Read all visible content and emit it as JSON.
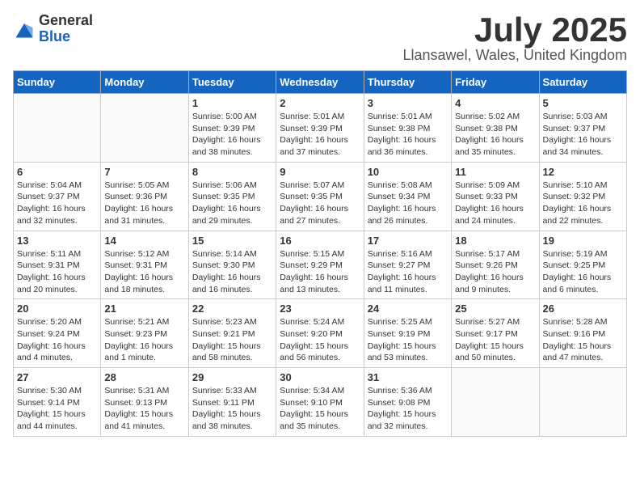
{
  "logo": {
    "general": "General",
    "blue": "Blue"
  },
  "title": "July 2025",
  "location": "Llansawel, Wales, United Kingdom",
  "weekdays": [
    "Sunday",
    "Monday",
    "Tuesday",
    "Wednesday",
    "Thursday",
    "Friday",
    "Saturday"
  ],
  "weeks": [
    [
      {
        "day": "",
        "info": ""
      },
      {
        "day": "",
        "info": ""
      },
      {
        "day": "1",
        "info": "Sunrise: 5:00 AM\nSunset: 9:39 PM\nDaylight: 16 hours\nand 38 minutes."
      },
      {
        "day": "2",
        "info": "Sunrise: 5:01 AM\nSunset: 9:39 PM\nDaylight: 16 hours\nand 37 minutes."
      },
      {
        "day": "3",
        "info": "Sunrise: 5:01 AM\nSunset: 9:38 PM\nDaylight: 16 hours\nand 36 minutes."
      },
      {
        "day": "4",
        "info": "Sunrise: 5:02 AM\nSunset: 9:38 PM\nDaylight: 16 hours\nand 35 minutes."
      },
      {
        "day": "5",
        "info": "Sunrise: 5:03 AM\nSunset: 9:37 PM\nDaylight: 16 hours\nand 34 minutes."
      }
    ],
    [
      {
        "day": "6",
        "info": "Sunrise: 5:04 AM\nSunset: 9:37 PM\nDaylight: 16 hours\nand 32 minutes."
      },
      {
        "day": "7",
        "info": "Sunrise: 5:05 AM\nSunset: 9:36 PM\nDaylight: 16 hours\nand 31 minutes."
      },
      {
        "day": "8",
        "info": "Sunrise: 5:06 AM\nSunset: 9:35 PM\nDaylight: 16 hours\nand 29 minutes."
      },
      {
        "day": "9",
        "info": "Sunrise: 5:07 AM\nSunset: 9:35 PM\nDaylight: 16 hours\nand 27 minutes."
      },
      {
        "day": "10",
        "info": "Sunrise: 5:08 AM\nSunset: 9:34 PM\nDaylight: 16 hours\nand 26 minutes."
      },
      {
        "day": "11",
        "info": "Sunrise: 5:09 AM\nSunset: 9:33 PM\nDaylight: 16 hours\nand 24 minutes."
      },
      {
        "day": "12",
        "info": "Sunrise: 5:10 AM\nSunset: 9:32 PM\nDaylight: 16 hours\nand 22 minutes."
      }
    ],
    [
      {
        "day": "13",
        "info": "Sunrise: 5:11 AM\nSunset: 9:31 PM\nDaylight: 16 hours\nand 20 minutes."
      },
      {
        "day": "14",
        "info": "Sunrise: 5:12 AM\nSunset: 9:31 PM\nDaylight: 16 hours\nand 18 minutes."
      },
      {
        "day": "15",
        "info": "Sunrise: 5:14 AM\nSunset: 9:30 PM\nDaylight: 16 hours\nand 16 minutes."
      },
      {
        "day": "16",
        "info": "Sunrise: 5:15 AM\nSunset: 9:29 PM\nDaylight: 16 hours\nand 13 minutes."
      },
      {
        "day": "17",
        "info": "Sunrise: 5:16 AM\nSunset: 9:27 PM\nDaylight: 16 hours\nand 11 minutes."
      },
      {
        "day": "18",
        "info": "Sunrise: 5:17 AM\nSunset: 9:26 PM\nDaylight: 16 hours\nand 9 minutes."
      },
      {
        "day": "19",
        "info": "Sunrise: 5:19 AM\nSunset: 9:25 PM\nDaylight: 16 hours\nand 6 minutes."
      }
    ],
    [
      {
        "day": "20",
        "info": "Sunrise: 5:20 AM\nSunset: 9:24 PM\nDaylight: 16 hours\nand 4 minutes."
      },
      {
        "day": "21",
        "info": "Sunrise: 5:21 AM\nSunset: 9:23 PM\nDaylight: 16 hours\nand 1 minute."
      },
      {
        "day": "22",
        "info": "Sunrise: 5:23 AM\nSunset: 9:21 PM\nDaylight: 15 hours\nand 58 minutes."
      },
      {
        "day": "23",
        "info": "Sunrise: 5:24 AM\nSunset: 9:20 PM\nDaylight: 15 hours\nand 56 minutes."
      },
      {
        "day": "24",
        "info": "Sunrise: 5:25 AM\nSunset: 9:19 PM\nDaylight: 15 hours\nand 53 minutes."
      },
      {
        "day": "25",
        "info": "Sunrise: 5:27 AM\nSunset: 9:17 PM\nDaylight: 15 hours\nand 50 minutes."
      },
      {
        "day": "26",
        "info": "Sunrise: 5:28 AM\nSunset: 9:16 PM\nDaylight: 15 hours\nand 47 minutes."
      }
    ],
    [
      {
        "day": "27",
        "info": "Sunrise: 5:30 AM\nSunset: 9:14 PM\nDaylight: 15 hours\nand 44 minutes."
      },
      {
        "day": "28",
        "info": "Sunrise: 5:31 AM\nSunset: 9:13 PM\nDaylight: 15 hours\nand 41 minutes."
      },
      {
        "day": "29",
        "info": "Sunrise: 5:33 AM\nSunset: 9:11 PM\nDaylight: 15 hours\nand 38 minutes."
      },
      {
        "day": "30",
        "info": "Sunrise: 5:34 AM\nSunset: 9:10 PM\nDaylight: 15 hours\nand 35 minutes."
      },
      {
        "day": "31",
        "info": "Sunrise: 5:36 AM\nSunset: 9:08 PM\nDaylight: 15 hours\nand 32 minutes."
      },
      {
        "day": "",
        "info": ""
      },
      {
        "day": "",
        "info": ""
      }
    ]
  ]
}
